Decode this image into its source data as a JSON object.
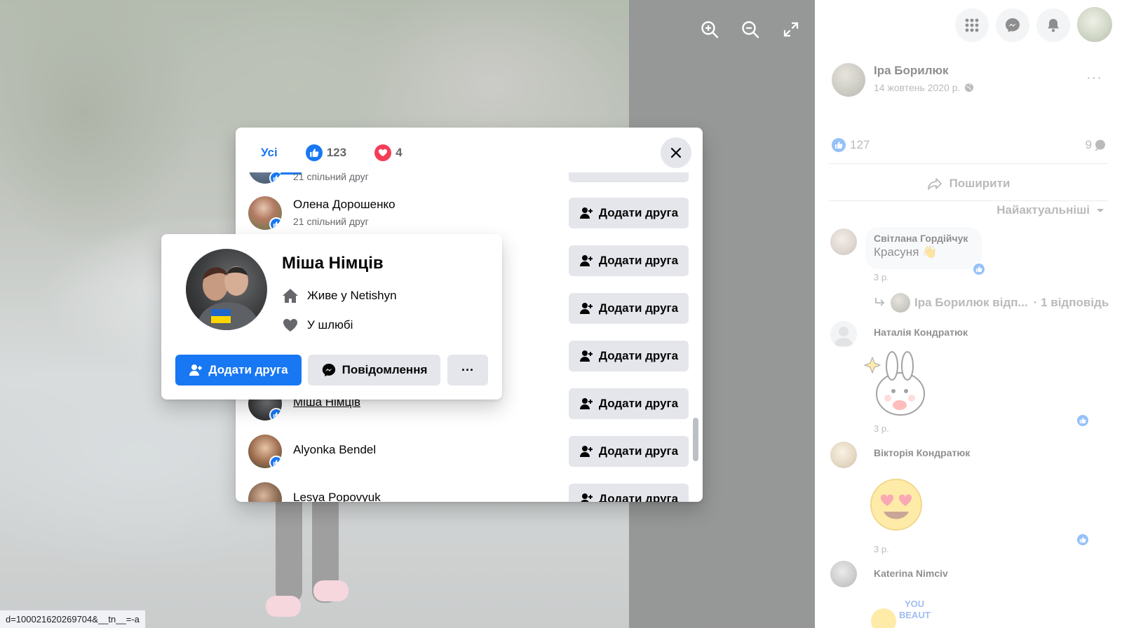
{
  "viewer": {
    "zoom_in_icon": "zoom-in-icon",
    "zoom_out_icon": "zoom-out-icon",
    "fullscreen_icon": "fullscreen-icon"
  },
  "post": {
    "author": "Іра Борилюк",
    "date": "14 жовтень 2020 р.",
    "like_count": "127",
    "comment_count": "9",
    "share_label": "Поширити",
    "sort_label": "Найактуальніші",
    "comments": [
      {
        "author": "Світлана Гордійчук",
        "text": "Красуня",
        "time": "3 р."
      },
      {
        "author": "Наталія Кондратюк",
        "text": "",
        "time": "3 р."
      },
      {
        "author": "Вікторія Кондратюк",
        "text": "",
        "time": "3 р."
      },
      {
        "author": "Katerina Nimciv",
        "text": "",
        "time": ""
      }
    ],
    "reply_author": "Іра Борилюк відп...",
    "reply_count": "· 1 відповідь"
  },
  "dialog": {
    "tabs": [
      {
        "label": "Усі"
      },
      {
        "label": "123",
        "icon": "like-icon"
      },
      {
        "label": "4",
        "icon": "love-icon"
      }
    ],
    "people": [
      {
        "name": "",
        "mutual": "21 спільний друг"
      },
      {
        "name": "Олена Дорошенко",
        "mutual": "21 спільний друг"
      },
      {
        "name": "",
        "mutual": ""
      },
      {
        "name": "",
        "mutual": ""
      },
      {
        "name": "",
        "mutual": ""
      },
      {
        "name": "Міша Німців",
        "mutual": ""
      },
      {
        "name": "Alyonka Bendel",
        "mutual": ""
      },
      {
        "name": "Lesya Popovyuk",
        "mutual": ""
      }
    ],
    "add_friend_label": "Додати друга"
  },
  "hover_card": {
    "name": "Міша Німців",
    "lives_prefix": "Живе у ",
    "lives_city": "Netishyn",
    "relationship": "У шлюбі",
    "add_friend_label": "Додати друга",
    "message_label": "Повідомлення",
    "more_label": "···"
  },
  "status_url": "d=100021620269704&__tn__=-a",
  "colors": {
    "accent": "#1877f2",
    "love": "#f33e58",
    "button_gray": "#e4e6eb"
  }
}
